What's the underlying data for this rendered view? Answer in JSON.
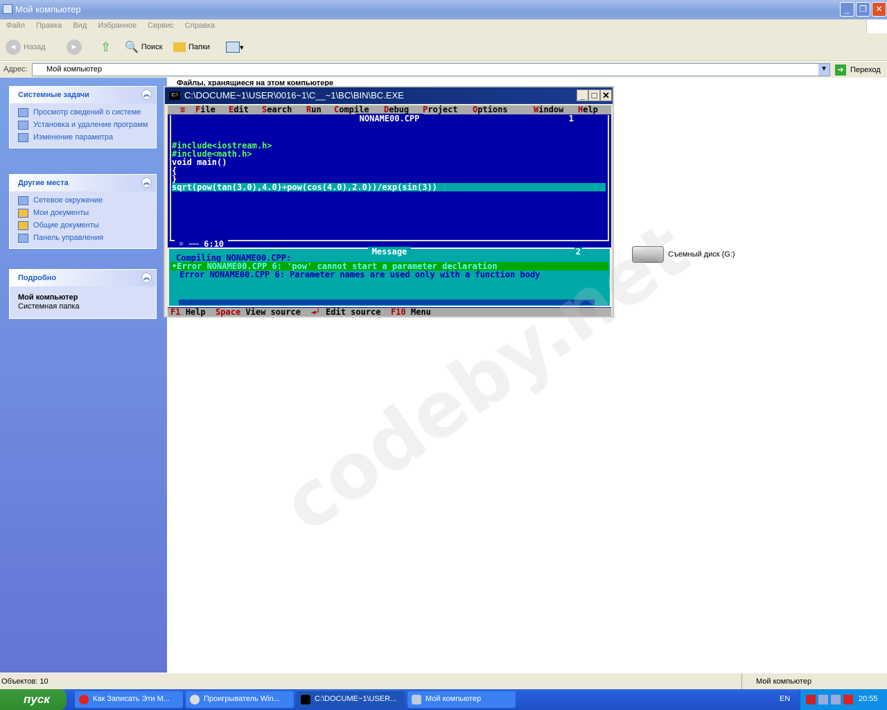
{
  "window": {
    "title": "Мой компьютер"
  },
  "menu": [
    "Файл",
    "Правка",
    "Вид",
    "Избранное",
    "Сервис",
    "Справка"
  ],
  "toolbar": {
    "back": "Назад",
    "search": "Поиск",
    "folders": "Папки"
  },
  "address": {
    "label": "Адрес:",
    "value": "Мой компьютер",
    "go": "Переход"
  },
  "sidebar": {
    "system_tasks": {
      "title": "Системные задачи",
      "items": [
        "Просмотр сведений о системе",
        "Установка и удаление программ",
        "Изменение параметра"
      ]
    },
    "other_places": {
      "title": "Другие места",
      "items": [
        "Сетевое окружение",
        "Мои документы",
        "Общие документы",
        "Панель управления"
      ]
    },
    "details": {
      "title": "Подробно",
      "name": "Мой компьютер",
      "type": "Системная папка"
    }
  },
  "content": {
    "header": "Файлы, хранящиеся на этом компьютере",
    "drive": "Съемный диск (G:)",
    "watermark": "codeby.net"
  },
  "dos": {
    "title": "C:\\DOCUME~1\\USER\\0016~1\\C__~1\\BC\\BIN\\BC.EXE",
    "menu": [
      "≡",
      "File",
      "Edit",
      "Search",
      "Run",
      "Compile",
      "Debug",
      "Project",
      "Options",
      "Window",
      "Help"
    ],
    "editor_title": "NONAME00.CPP",
    "window_num": "1",
    "code": [
      "#include<iostream.h>",
      "#include<math.h>",
      "void main()",
      "{",
      "}",
      "sqrt(pow(tan(3.0),4.0)+pow(cos(4.0),2.0))/exp(sin(3))"
    ],
    "cursor_pos": "6:10",
    "message_title": "Message",
    "message_num": "2",
    "messages": [
      "Compiling NONAME00.CPP:",
      "•Error NONAME00.CPP 6: 'pow' cannot start a parameter declaration",
      " Error NONAME00.CPP 6: Parameter names are used only with a function body"
    ],
    "status": [
      {
        "key": "F1",
        "label": "Help"
      },
      {
        "key": "Space",
        "label": "View source"
      },
      {
        "key": "◄┘",
        "label": "Edit source"
      },
      {
        "key": "F10",
        "label": "Menu"
      }
    ]
  },
  "statusbar": {
    "objects": "Объектов: 10",
    "location": "Мой компьютер"
  },
  "taskbar": {
    "start": "пуск",
    "tasks": [
      "Как Записать Эти М...",
      "Проигрыватель Win...",
      "C:\\DOCUME~1\\USER...",
      "Мой компьютер"
    ],
    "lang": "EN",
    "clock": "20:55"
  }
}
